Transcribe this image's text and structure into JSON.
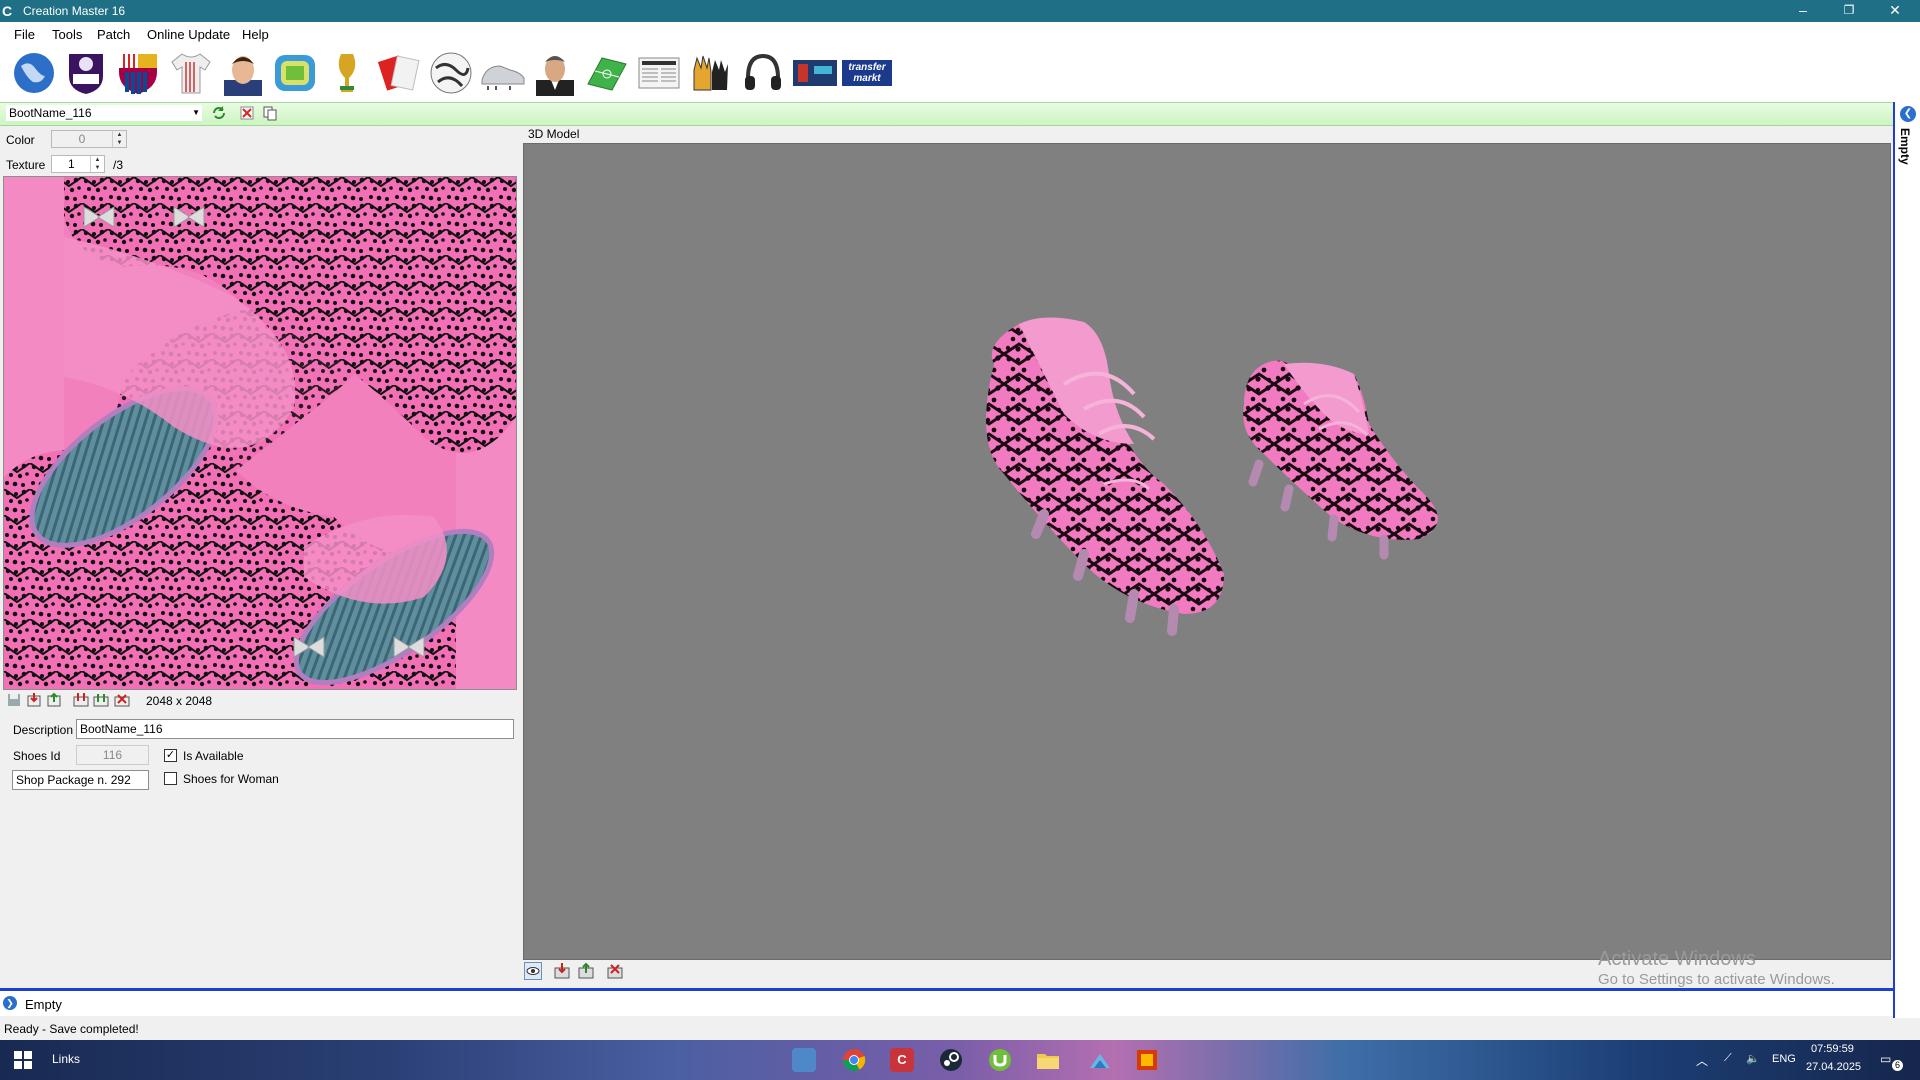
{
  "window": {
    "title": "Creation Master 16",
    "app_icon_glyph": "C",
    "controls": {
      "minimize": "–",
      "restore": "❐",
      "close": "✕"
    }
  },
  "menu": [
    "File",
    "Tools",
    "Patch",
    "Online Update",
    "Help"
  ],
  "toolbar": {
    "icons": [
      "world-globe-icon",
      "premier-league-icon",
      "fc-barcelona-crest-icon",
      "jersey-icon",
      "player-face-icon",
      "stadium-icon",
      "world-cup-trophy-icon",
      "referee-cards-icon",
      "football-ball-icon",
      "boots-icon",
      "manager-face-icon",
      "pitch-icon",
      "newspaper-icon",
      "goalkeeper-gloves-icon",
      "headphones-icon",
      "fifa-cover-icon",
      "transfermarkt-icon"
    ],
    "transfermarkt_logo_text": "transfer markt"
  },
  "selector": {
    "value": "BootName_116",
    "actions": [
      "refresh-icon",
      "delete-icon",
      "copy-icon"
    ]
  },
  "left_panel": {
    "color_label": "Color",
    "color_value": "0",
    "texture_label": "Texture",
    "texture_value": "1",
    "texture_total": "/3",
    "texture_size": "2048 x 2048",
    "texture_tools": [
      "save-icon",
      "import-icon",
      "export-icon",
      "import-all-icon",
      "export-all-icon",
      "remove-icon"
    ],
    "description_label": "Description",
    "description_value": "BootName_116",
    "shoes_id_label": "Shoes Id",
    "shoes_id_value": "116",
    "is_available_label": "Is Available",
    "is_available_checked": true,
    "shop_package_value": "Shop Package n. 292",
    "shoes_for_woman_label": "Shoes for Woman",
    "shoes_for_woman_checked": false,
    "checkmark": "✓"
  },
  "viewport": {
    "label": "3D Model",
    "tools": [
      "eye-icon",
      "import-model-icon",
      "export-model-icon",
      "reset-view-icon"
    ]
  },
  "watermark": {
    "line1": "Activate Windows",
    "line2": "Go to Settings to activate Windows."
  },
  "right_panel": {
    "label": "Empty"
  },
  "bottom_panel": {
    "label": "Empty"
  },
  "status": {
    "text": "Ready - Save completed!"
  },
  "taskbar": {
    "links_label": "Links",
    "lang": "ENG",
    "time": "07:59:59",
    "date": "27.04.2025",
    "notif_count": "6",
    "apps": [
      "store-icon",
      "chrome-icon",
      "creation-master-icon",
      "steam-icon",
      "utorrent-icon",
      "file-explorer-icon",
      "winrar-icon",
      "office-icon"
    ]
  },
  "colors": {
    "titlebar": "#1f6f86",
    "accent_blue": "#1f3fd0",
    "boot_pink": "#f07ac0",
    "viewport_gray": "#808080"
  }
}
